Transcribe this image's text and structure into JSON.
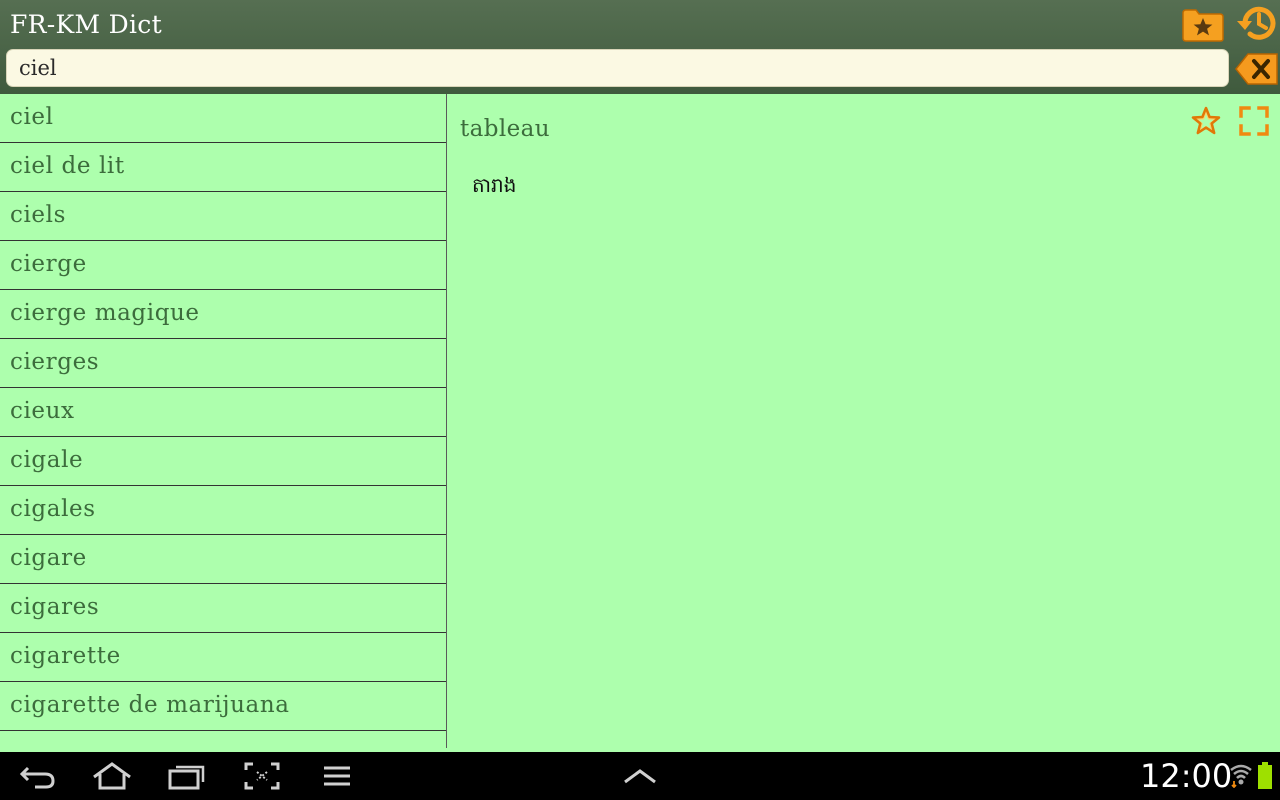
{
  "app": {
    "title": "FR-KM Dict"
  },
  "toolbar": {
    "favorites_icon": "star-folder-icon",
    "history_icon": "history-icon"
  },
  "search": {
    "value": "ciel",
    "placeholder": "",
    "clear_icon": "backspace-x-icon"
  },
  "word_list": {
    "items": [
      "ciel",
      "ciel de lit",
      "ciels",
      "cierge",
      "cierge magique",
      "cierges",
      "cieux",
      "cigale",
      "cigales",
      "cigare",
      "cigares",
      "cigarette",
      "cigarette de marijuana",
      ""
    ]
  },
  "detail": {
    "headword": "tableau",
    "translation": "តារាង",
    "star_icon": "star-outline-icon",
    "fullscreen_icon": "fullscreen-icon"
  },
  "system_bar": {
    "time": "12:00",
    "buttons": [
      "back-icon",
      "home-icon",
      "recent-apps-icon",
      "screenshot-icon",
      "menu-icon",
      "chevron-up-icon"
    ]
  },
  "colors": {
    "appbar": "#4a6447",
    "content_bg": "#adffad",
    "accent_orange": "#f08a10",
    "list_text": "#3c6c3c"
  }
}
